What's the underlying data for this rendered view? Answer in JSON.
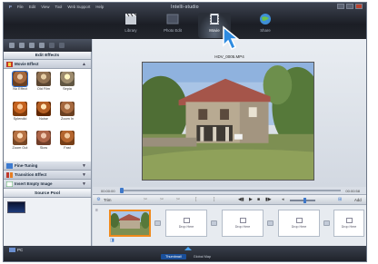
{
  "app": {
    "title": "Intelli-studio",
    "menu": [
      "File",
      "Edit",
      "View",
      "Tool",
      "Web Support",
      "Help"
    ]
  },
  "modules": [
    {
      "label": "Library",
      "active": false
    },
    {
      "label": "Photo Edit",
      "active": false
    },
    {
      "label": "Movie",
      "active": true
    },
    {
      "label": "Share",
      "active": false
    }
  ],
  "edit_panel": {
    "title": "Edit Effects",
    "movie_effect_label": "Movie Effect",
    "effects": [
      "No Effect",
      "Old Film",
      "Sepia",
      "Splendid",
      "Noise",
      "Zoom In",
      "Zoom Out",
      "Slow",
      "Fast"
    ],
    "sections": [
      "Fine-Tuning",
      "Transition Effect",
      "Insert Empty Image"
    ]
  },
  "source_pool": {
    "title": "Source Pool"
  },
  "player": {
    "filename": "HDV_0005.MP4",
    "time_current": "00:00:00",
    "time_total": "00:00:58",
    "trim_label": "Trim",
    "add_label": "Add",
    "progress": 0.0,
    "volume": 0.6
  },
  "timeline": {
    "drop_label": "Drop Here",
    "drop_slots": 4
  },
  "status": {
    "pc_label": "PC",
    "thumbnail_label": "Thumbnail",
    "global_label": "Global Map"
  },
  "colors": {
    "selection": "#f08a1c",
    "accent": "#3e78c9",
    "active_tab": "#1a4f9a"
  }
}
